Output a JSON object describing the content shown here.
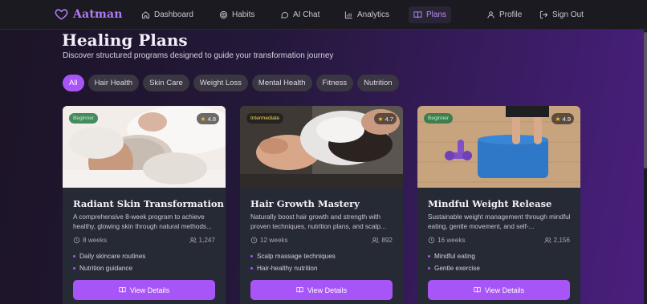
{
  "brand": {
    "name": "Aatman"
  },
  "nav": {
    "dashboard": "Dashboard",
    "habits": "Habits",
    "ai_chat": "AI Chat",
    "analytics": "Analytics",
    "plans": "Plans",
    "profile": "Profile",
    "sign_out": "Sign Out"
  },
  "page": {
    "title": "Healing Plans",
    "subtitle": "Discover structured programs designed to guide your transformation journey"
  },
  "filters": [
    "All",
    "Hair Health",
    "Skin Care",
    "Weight Loss",
    "Mental Health",
    "Fitness",
    "Nutrition"
  ],
  "active_filter": "All",
  "cards": [
    {
      "level": "Beginner",
      "rating": "4.8",
      "title": "Radiant Skin Transformation",
      "description": "A comprehensive 8-week program to achieve healthy, glowing skin through natural methods...",
      "duration": "8 weeks",
      "users": "1,247",
      "features": [
        "Daily skincare routines",
        "Nutrition guidance"
      ],
      "button": "View Details"
    },
    {
      "level": "Intermediate",
      "rating": "4.7",
      "title": "Hair Growth Mastery",
      "description": "Naturally boost hair growth and strength with proven techniques, nutrition plans, and scalp...",
      "duration": "12 weeks",
      "users": "892",
      "features": [
        "Scalp massage techniques",
        "Hair-healthy nutrition"
      ],
      "button": "View Details"
    },
    {
      "level": "Beginner",
      "rating": "4.9",
      "title": "Mindful Weight Release",
      "description": "Sustainable weight management through mindful eating, gentle movement, and self-...",
      "duration": "16 weeks",
      "users": "2,156",
      "features": [
        "Mindful eating",
        "Gentle exercise"
      ],
      "button": "View Details"
    }
  ],
  "colors": {
    "accent": "#a855f7",
    "brand": "#b07cf5",
    "card": "#262a34"
  }
}
